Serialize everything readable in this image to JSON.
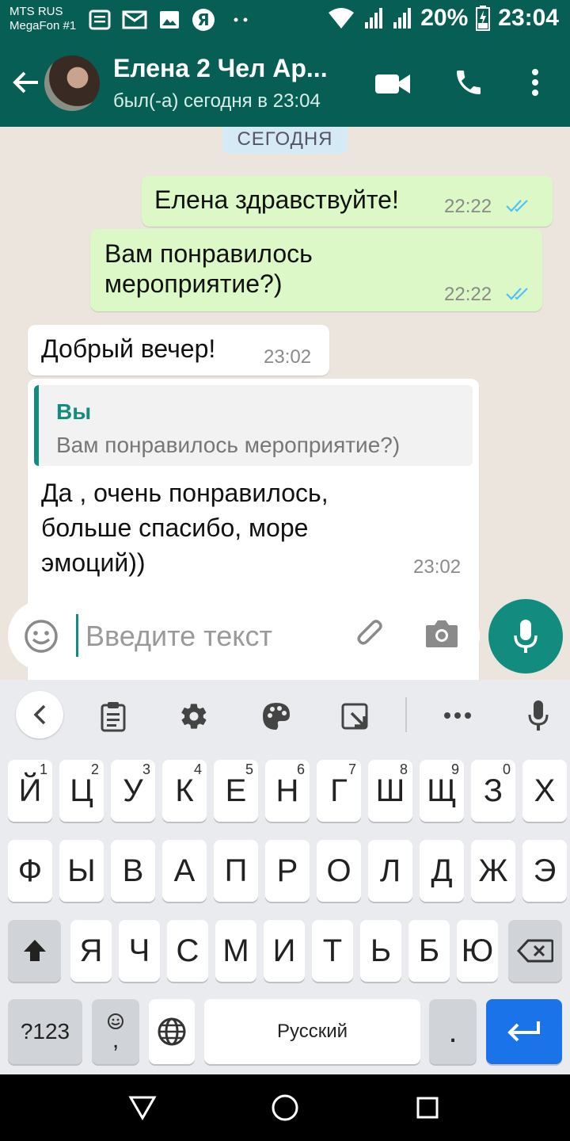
{
  "status_bar": {
    "carrier_1": "MTS RUS",
    "carrier_2": "MegaFon #1",
    "battery": "20%",
    "time": "23:04",
    "icons": [
      "notes-icon",
      "mail-icon",
      "image-icon",
      "yandex-icon",
      "more-dots-icon",
      "wifi-icon",
      "signal-icon",
      "signal-icon",
      "battery-charging-icon"
    ]
  },
  "header": {
    "contact_name": "Елена 2 Чел Ар...",
    "contact_status": "был(-а) сегодня в 23:04",
    "icons": [
      "back-arrow-icon",
      "video-call-icon",
      "phone-icon",
      "menu-dots-icon"
    ]
  },
  "chat": {
    "date_chip": "СЕГОДНЯ",
    "messages": [
      {
        "direction": "out",
        "text_lines": [
          "Елена здравствуйте!"
        ],
        "time": "22:22",
        "status": "read"
      },
      {
        "direction": "out",
        "text_lines": [
          "Вам понравилось",
          "мероприятие?)"
        ],
        "time": "22:22",
        "status": "read"
      },
      {
        "direction": "in",
        "text_lines": [
          "Добрый вечер!"
        ],
        "time": "23:02"
      },
      {
        "direction": "in",
        "reply_author": "Вы",
        "reply_text": "Вам понравилось мероприятие?)",
        "text_lines": [
          "Да , очень понравилось,",
          "больше спасибо, море",
          "эмоций))"
        ],
        "time": "23:02"
      }
    ]
  },
  "input": {
    "placeholder": "Введите текст",
    "value": ""
  },
  "keyboard": {
    "toolbar_icons": [
      "chevron-left-icon",
      "clipboard-icon",
      "settings-gear-icon",
      "palette-icon",
      "resize-icon",
      "more-dots-icon",
      "voice-mic-icon"
    ],
    "row1": [
      {
        "label": "Й",
        "hint": "1"
      },
      {
        "label": "Ц",
        "hint": "2"
      },
      {
        "label": "У",
        "hint": "3"
      },
      {
        "label": "К",
        "hint": "4"
      },
      {
        "label": "Е",
        "hint": "5"
      },
      {
        "label": "Н",
        "hint": "6"
      },
      {
        "label": "Г",
        "hint": "7"
      },
      {
        "label": "Ш",
        "hint": "8"
      },
      {
        "label": "Щ",
        "hint": "9"
      },
      {
        "label": "З",
        "hint": "0"
      },
      {
        "label": "Х",
        "hint": ""
      }
    ],
    "row2": [
      "Ф",
      "Ы",
      "В",
      "А",
      "П",
      "Р",
      "О",
      "Л",
      "Д",
      "Ж",
      "Э"
    ],
    "row3": [
      "Я",
      "Ч",
      "С",
      "М",
      "И",
      "Т",
      "Ь",
      "Б",
      "Ю"
    ],
    "numbers_key": "?123",
    "emoji_comma_key": ",",
    "space_label": "Русский",
    "period_key": "."
  },
  "colors": {
    "header": "#075e54",
    "accent": "#128c7e",
    "outgoing_bubble": "#dcf8c6",
    "read_ticks": "#4fc3f7",
    "enter_key": "#1a73e8"
  }
}
